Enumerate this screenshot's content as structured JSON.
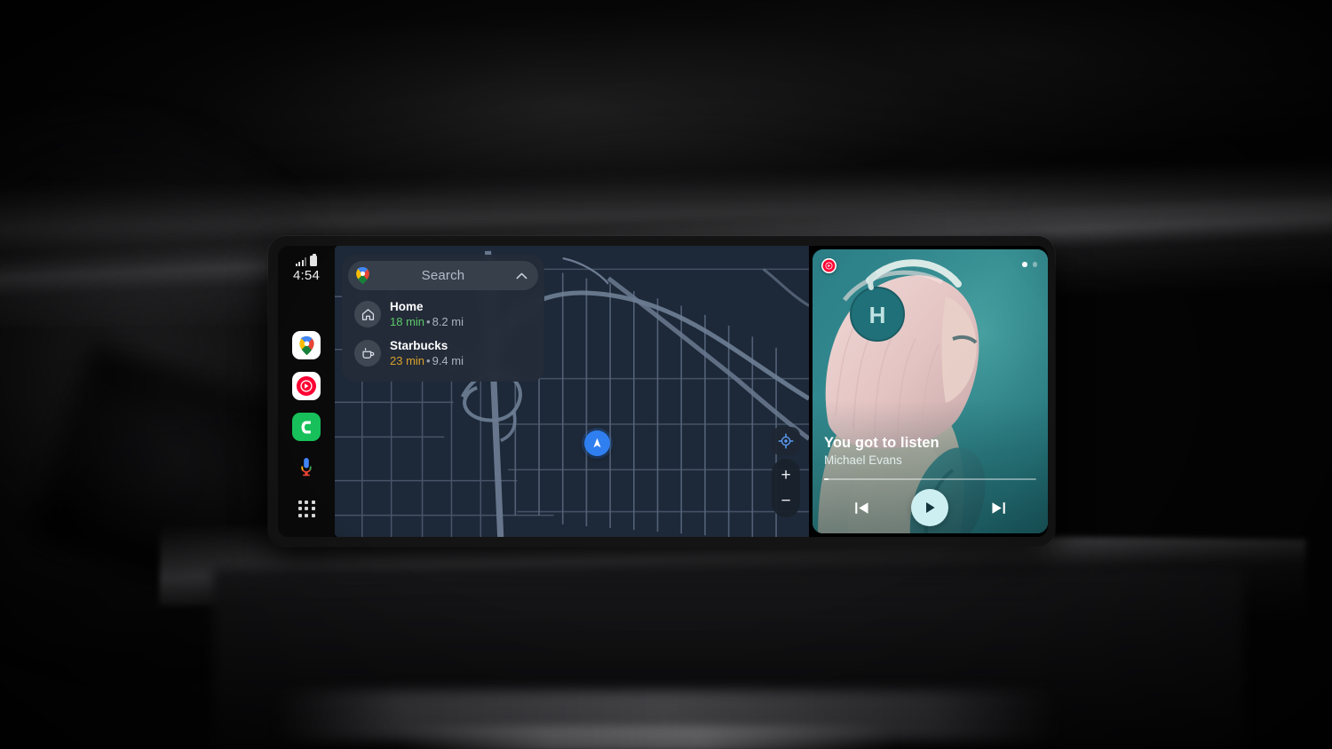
{
  "device": {
    "name": "car-infotainment-display"
  },
  "status_bar": {
    "time": "4:54",
    "signal_icon": "cellular-signal-icon",
    "battery_icon": "battery-icon"
  },
  "sidebar": {
    "apps": [
      {
        "name": "google-maps",
        "label": "Maps",
        "icon": "maps-pin-icon"
      },
      {
        "name": "youtube-music",
        "label": "YouTube Music",
        "icon": "youtube-music-icon"
      },
      {
        "name": "phone",
        "label": "Phone",
        "icon": "phone-icon"
      },
      {
        "name": "assistant",
        "label": "Google Assistant",
        "icon": "microphone-icon"
      },
      {
        "name": "app-launcher",
        "label": "All apps",
        "icon": "app-grid-icon"
      }
    ]
  },
  "map": {
    "search": {
      "placeholder": "Search",
      "app_icon": "maps-pin-icon",
      "collapse_icon": "chevron-up-icon"
    },
    "suggestions": [
      {
        "icon": "home-icon",
        "title": "Home",
        "eta": "18 min",
        "separator": "•",
        "distance": "8.2 mi",
        "eta_color": "#5cc96a"
      },
      {
        "icon": "coffee-cup-icon",
        "title": "Starbucks",
        "eta": "23 min",
        "separator": "•",
        "distance": "9.4 mi",
        "eta_color": "#d9a22a"
      }
    ],
    "controls": {
      "recenter_icon": "recenter-crosshair-icon",
      "zoom_in_label": "+",
      "zoom_out_label": "−"
    },
    "location_puck_icon": "navigation-arrow-icon",
    "colors": {
      "base": "#1d2838",
      "road": "#59687d",
      "puck": "#2f7ff0"
    }
  },
  "media": {
    "app_badge": "youtube-music-icon",
    "track_title": "You got to listen",
    "artist": "Michael Evans",
    "progress_percent": 2,
    "page_dots": [
      {
        "active": true
      },
      {
        "active": false
      }
    ],
    "controls": {
      "previous_icon": "skip-previous-icon",
      "play_icon": "play-icon",
      "next_icon": "skip-next-icon"
    },
    "colors": {
      "accent": "#2d7f84",
      "play_button": "#cdeff2"
    }
  }
}
